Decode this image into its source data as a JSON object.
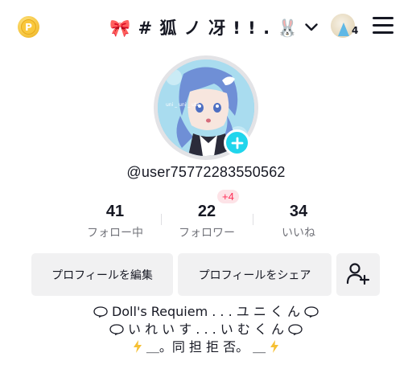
{
  "header": {
    "username": "🎀 # 狐 ノ 冴 ! ! . 🐰",
    "inbox_count": "4",
    "icons": {
      "coin": "coin-icon",
      "switch": "chevron-down-icon",
      "menu": "hamburger-menu-icon"
    }
  },
  "profile": {
    "handle": "@user75772283550562",
    "avatar_add_icon": "plus-icon"
  },
  "stats": [
    {
      "value": "41",
      "label": "フォロー中"
    },
    {
      "value": "22",
      "label": "フォロワー",
      "badge": "+4"
    },
    {
      "value": "34",
      "label": "いいね"
    }
  ],
  "actions": {
    "edit_profile": "プロフィールを編集",
    "share_profile": "プロフィールをシェア",
    "add_friend_icon": "add-person-icon"
  },
  "bio": {
    "line1": "Doll's Requiem . . . ユ ニ く ん",
    "line2": "い れ い す . . . い む く ん",
    "line3": "＿。同 担 拒 否。 ＿"
  },
  "colors": {
    "accent_cyan": "#20d5ec",
    "badge_red": "#fe2c55",
    "badge_bg": "#fde3e7",
    "button_bg": "#f1f1f2",
    "label_gray": "#73747b",
    "bolt_yellow": "#f6c033"
  }
}
